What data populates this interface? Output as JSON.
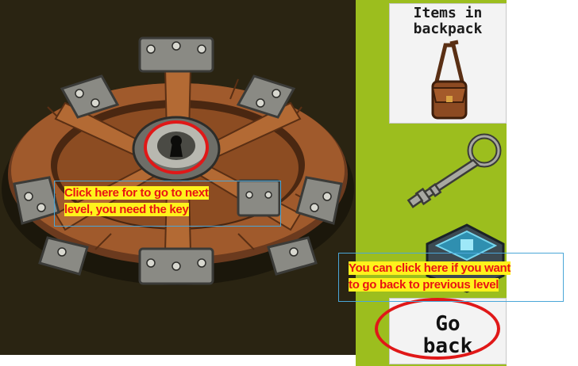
{
  "scene": {
    "object": "round-wooden-hatch-with-keyhole"
  },
  "backpack": {
    "title": "Items in\nbackpack",
    "items": [
      "leather-bag",
      "skeleton-key",
      "tech-device"
    ]
  },
  "go_back": {
    "label": "Go\nback"
  },
  "annotations": {
    "next_level": [
      "Click here for to go to next",
      "level, you need the key"
    ],
    "previous_level": [
      "You can click here if you want",
      "to go back to previous level"
    ]
  },
  "colors": {
    "background_dark": "#2a2412",
    "sidebar_green": "#9cbe1e",
    "wood": "#a05a2c",
    "metal": "#8a8a84",
    "annotation_text": "#e81414",
    "annotation_highlight": "#fff21c",
    "annotation_box": "#4aa6d8",
    "ring_red": "#e01818"
  }
}
